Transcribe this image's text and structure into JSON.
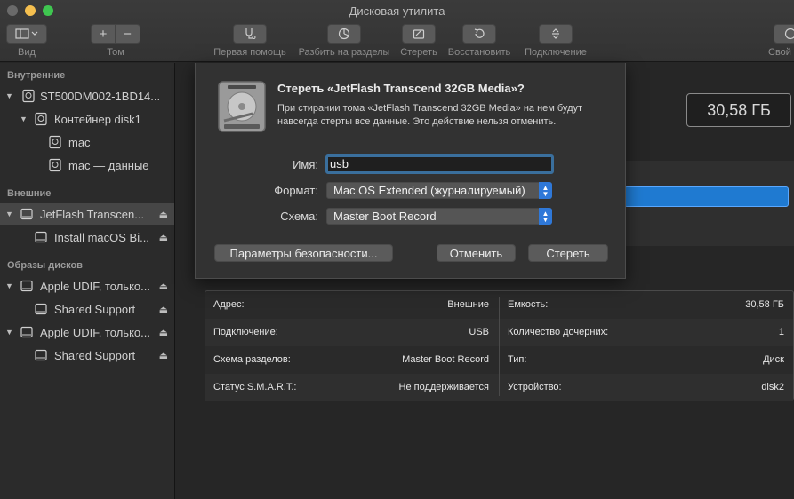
{
  "window": {
    "title": "Дисковая утилита"
  },
  "toolbar": {
    "view_label": "Вид",
    "volume_label": "Том",
    "volume_add": "+",
    "volume_remove": "−",
    "first_aid_label": "Первая помощь",
    "partition_label": "Разбить на разделы",
    "erase_label": "Стереть",
    "restore_label": "Восстановить",
    "mount_label": "Подключение",
    "info_label": "Свой"
  },
  "sidebar": {
    "sections": {
      "internal": "Внутренние",
      "external": "Внешние",
      "images": "Образы дисков"
    },
    "items": [
      {
        "label": "ST500DM002-1BD14..."
      },
      {
        "label": "Контейнер disk1"
      },
      {
        "label": "mac"
      },
      {
        "label": "mac — данные"
      },
      {
        "label": "JetFlash Transcen..."
      },
      {
        "label": "Install macOS Bi..."
      },
      {
        "label": "Apple UDIF, только..."
      },
      {
        "label": "Shared Support"
      },
      {
        "label": "Apple UDIF, только..."
      },
      {
        "label": "Shared Support"
      }
    ]
  },
  "main": {
    "capacity": "30,58 ГБ",
    "info": [
      {
        "left_key": "Адрес:",
        "left_value": "Внешние",
        "right_key": "Емкость:",
        "right_value": "30,58 ГБ"
      },
      {
        "left_key": "Подключение:",
        "left_value": "USB",
        "right_key": "Количество дочерних:",
        "right_value": "1"
      },
      {
        "left_key": "Схема разделов:",
        "left_value": "Master Boot Record",
        "right_key": "Тип:",
        "right_value": "Диск"
      },
      {
        "left_key": "Статус S.M.A.R.T.:",
        "left_value": "Не поддерживается",
        "right_key": "Устройство:",
        "right_value": "disk2"
      }
    ]
  },
  "dialog": {
    "title": "Стереть «JetFlash Transcend 32GB Media»?",
    "message": "При стирании тома «JetFlash Transcend 32GB Media» на нем будут навсегда стерты все данные. Это действие нельзя отменить.",
    "name_label": "Имя:",
    "name_value": "usb",
    "format_label": "Формат:",
    "format_value": "Mac OS Extended (журналируемый)",
    "scheme_label": "Схема:",
    "scheme_value": "Master Boot Record",
    "security_button": "Параметры безопасности...",
    "cancel_button": "Отменить",
    "erase_button": "Стереть"
  },
  "colors": {
    "accent": "#2f78d8",
    "usage_bar": "#1f7ad1"
  }
}
